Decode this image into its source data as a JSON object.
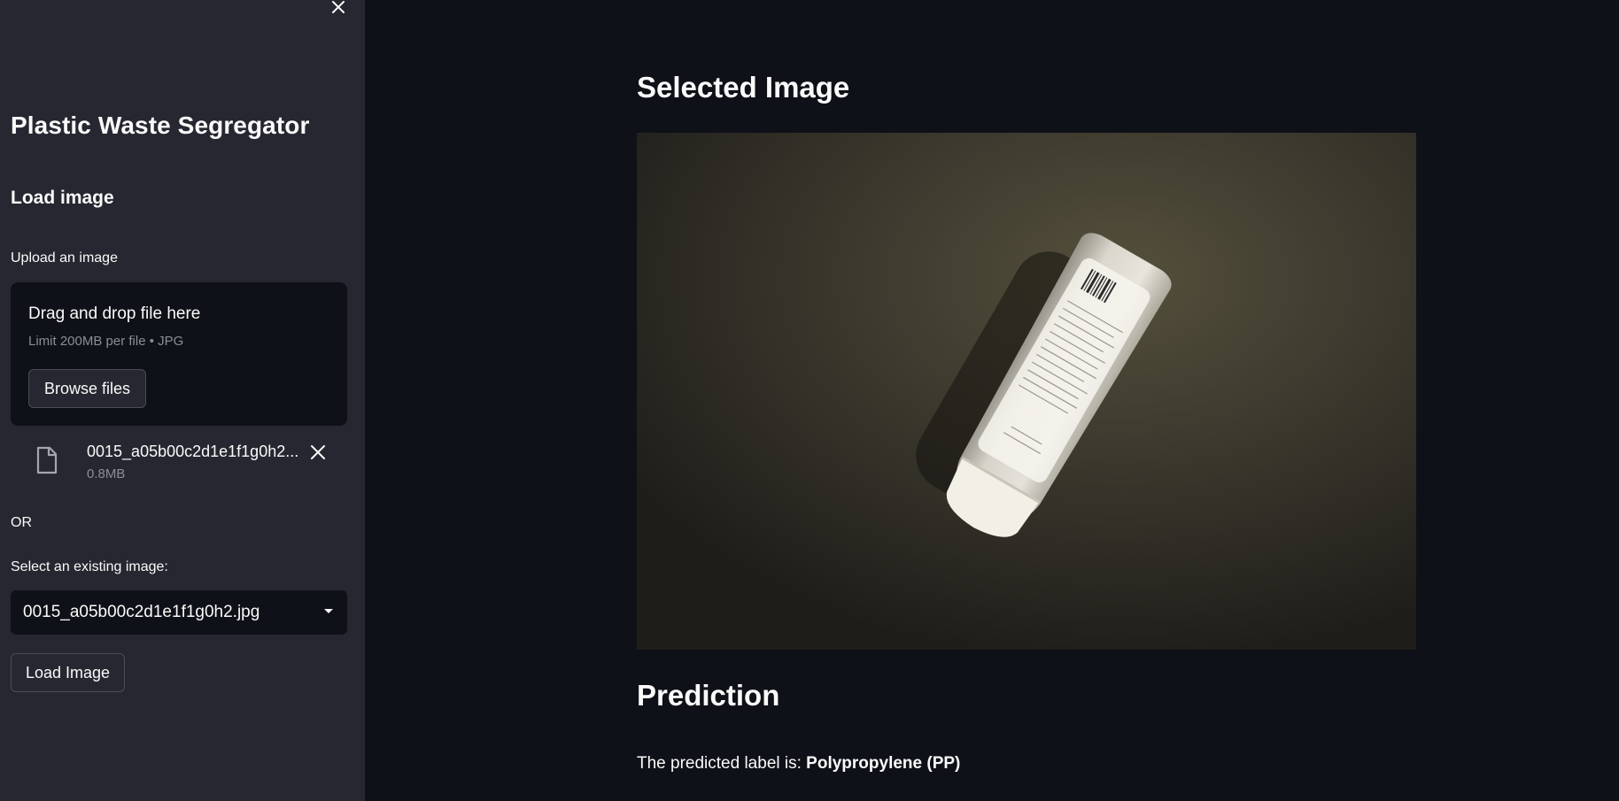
{
  "sidebar": {
    "title": "Plastic Waste Segregator",
    "section_heading": "Load image",
    "upload": {
      "label": "Upload an image",
      "dropzone_title": "Drag and drop file here",
      "dropzone_limit": "Limit 200MB per file • JPG",
      "browse_label": "Browse files"
    },
    "uploaded_file": {
      "name": "0015_a05b00c2d1e1f1g0h2...",
      "size": "0.8MB"
    },
    "or_text": "OR",
    "select": {
      "label": "Select an existing image:",
      "value": "0015_a05b00c2d1e1f1g0h2.jpg"
    },
    "load_button_label": "Load Image"
  },
  "main": {
    "selected_heading": "Selected Image",
    "prediction_heading": "Prediction",
    "prediction_prefix": "The predicted label is: ",
    "prediction_label": "Polypropylene (PP)"
  },
  "icons": {
    "close": "close-icon",
    "file": "file-icon",
    "remove": "remove-file-icon",
    "chevron": "chevron-down-icon"
  },
  "colors": {
    "sidebar_bg": "#262730",
    "main_bg": "#0e1117",
    "text": "#fafafa",
    "muted_text": "#8b8e96"
  }
}
